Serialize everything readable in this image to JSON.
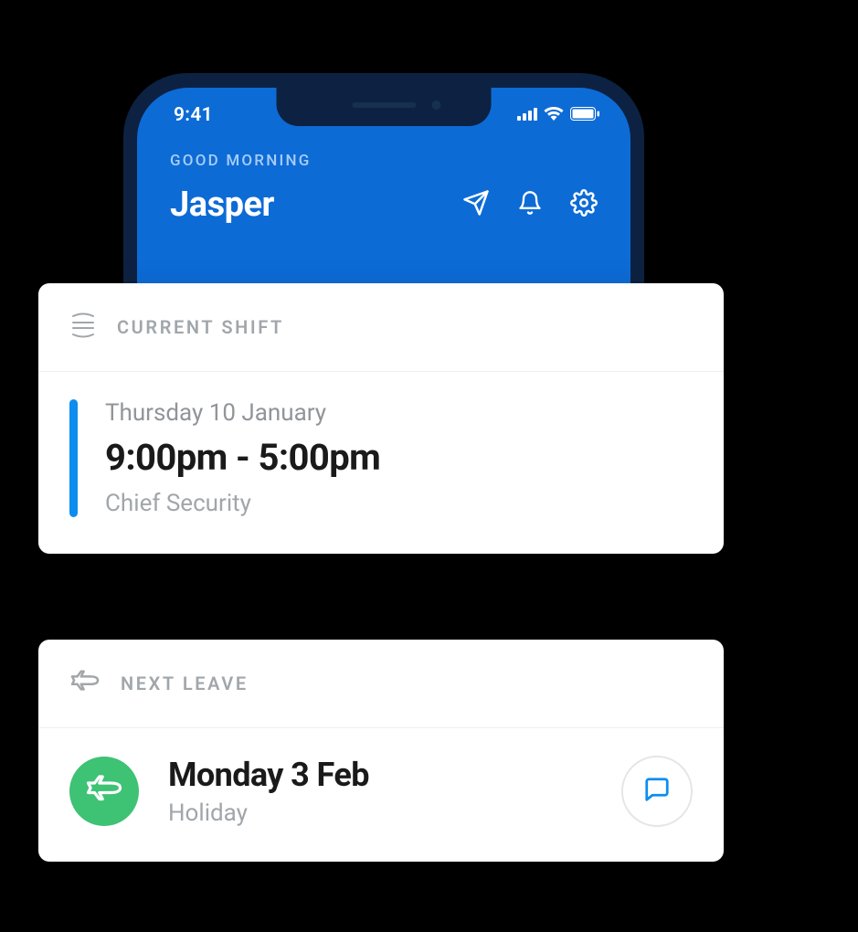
{
  "status_bar": {
    "time": "9:41"
  },
  "header": {
    "greeting_label": "GOOD MORNING",
    "user_name": "Jasper"
  },
  "current_shift": {
    "title": "CURRENT SHIFT",
    "date": "Thursday 10 January",
    "time_range": "9:00pm - 5:00pm",
    "role": "Chief Security"
  },
  "next_leave": {
    "title": "NEXT LEAVE",
    "date": "Monday 3 Feb",
    "type": "Holiday"
  }
}
